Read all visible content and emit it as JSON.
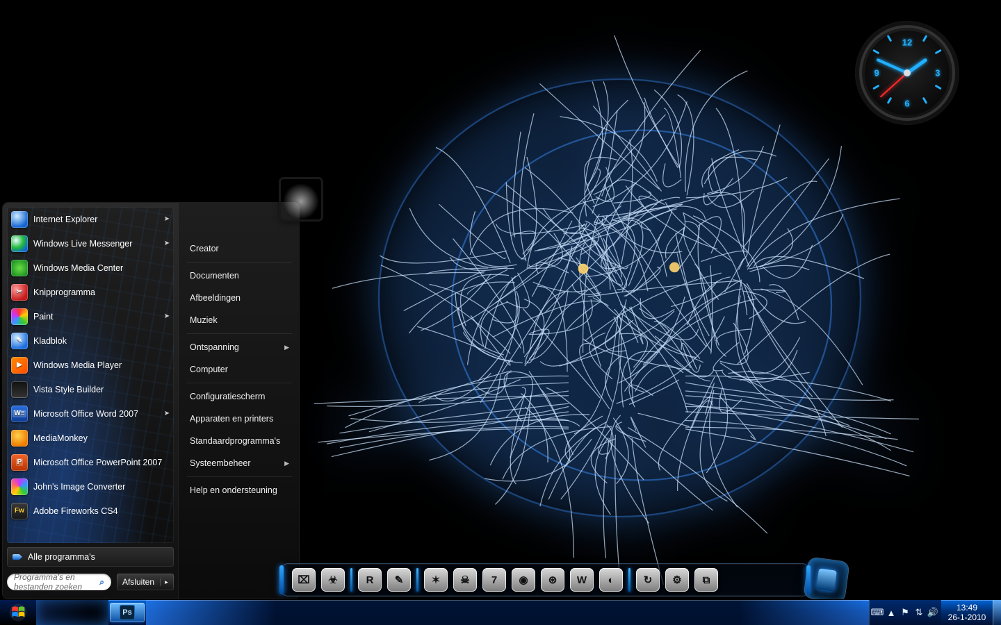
{
  "start_menu": {
    "programs": [
      {
        "label": "Internet Explorer",
        "icon": "ie-icon",
        "expandable": true
      },
      {
        "label": "Windows Live Messenger",
        "icon": "messenger-icon",
        "expandable": true
      },
      {
        "label": "Windows Media Center",
        "icon": "media-center-icon",
        "expandable": false
      },
      {
        "label": "Knipprogramma",
        "icon": "snipping-icon",
        "expandable": false
      },
      {
        "label": "Paint",
        "icon": "paint-icon",
        "expandable": true
      },
      {
        "label": "Kladblok",
        "icon": "notepad-icon",
        "expandable": false
      },
      {
        "label": "Windows Media Player",
        "icon": "wmp-icon",
        "expandable": false
      },
      {
        "label": "Vista Style Builder",
        "icon": "vsb-icon",
        "expandable": false
      },
      {
        "label": "Microsoft Office Word 2007",
        "icon": "word-icon",
        "expandable": true
      },
      {
        "label": "MediaMonkey",
        "icon": "mediamonkey-icon",
        "expandable": false
      },
      {
        "label": "Microsoft Office PowerPoint 2007",
        "icon": "powerpoint-icon",
        "expandable": false
      },
      {
        "label": "John's Image Converter",
        "icon": "jic-icon",
        "expandable": false
      },
      {
        "label": "Adobe Fireworks CS4",
        "icon": "fireworks-icon",
        "expandable": false
      }
    ],
    "all_programs_label": "Alle programma's",
    "search_placeholder": "Programma's en bestanden zoeken",
    "shutdown_label": "Afsluiten",
    "right_links": [
      {
        "label": "Creator",
        "expandable": false
      },
      {
        "label": "Documenten",
        "expandable": false
      },
      {
        "label": "Afbeeldingen",
        "expandable": false
      },
      {
        "label": "Muziek",
        "expandable": false
      },
      {
        "label": "Ontspanning",
        "expandable": true
      },
      {
        "label": "Computer",
        "expandable": false
      },
      {
        "label": "Configuratiescherm",
        "expandable": false
      },
      {
        "label": "Apparaten en printers",
        "expandable": false
      },
      {
        "label": "Standaardprogramma's",
        "expandable": false
      },
      {
        "label": "Systeembeheer",
        "expandable": true
      },
      {
        "label": "Help en ondersteuning",
        "expandable": false
      }
    ],
    "right_separators_after": [
      0,
      3,
      5,
      9
    ]
  },
  "clock_gadget": {
    "numerals": [
      "12",
      "3",
      "6",
      "9"
    ],
    "hour": 1,
    "minute": 49,
    "second": 38
  },
  "dock_items": [
    {
      "name": "monitor-icon",
      "glyph": "⌧"
    },
    {
      "name": "biohazard-icon",
      "glyph": "☣"
    },
    {
      "name": "r-app-icon",
      "glyph": "R"
    },
    {
      "name": "feather-icon",
      "glyph": "✎"
    },
    {
      "name": "shield-icon",
      "glyph": "✶"
    },
    {
      "name": "skull-icon",
      "glyph": "☠"
    },
    {
      "name": "7-icon",
      "glyph": "7"
    },
    {
      "name": "swirl-icon",
      "glyph": "◉"
    },
    {
      "name": "globe-icon",
      "glyph": "⊛"
    },
    {
      "name": "w-app-icon",
      "glyph": "W"
    },
    {
      "name": "aperture-icon",
      "glyph": "◐"
    },
    {
      "name": "refresh-icon",
      "glyph": "↻"
    },
    {
      "name": "gear-icon",
      "glyph": "⚙"
    },
    {
      "name": "cube-icon",
      "glyph": "⧉"
    }
  ],
  "taskbar": {
    "running": [
      {
        "name": "photoshop",
        "glyph": "Ps"
      }
    ],
    "tray_icons": [
      {
        "name": "input-indicator-icon",
        "glyph": "⌨"
      },
      {
        "name": "show-hidden-icon",
        "glyph": "▲"
      },
      {
        "name": "action-center-icon",
        "glyph": "⚑"
      },
      {
        "name": "network-icon",
        "glyph": "⇅"
      },
      {
        "name": "volume-icon",
        "glyph": "🔊"
      }
    ],
    "time": "13:49",
    "date": "26-1-2010"
  }
}
